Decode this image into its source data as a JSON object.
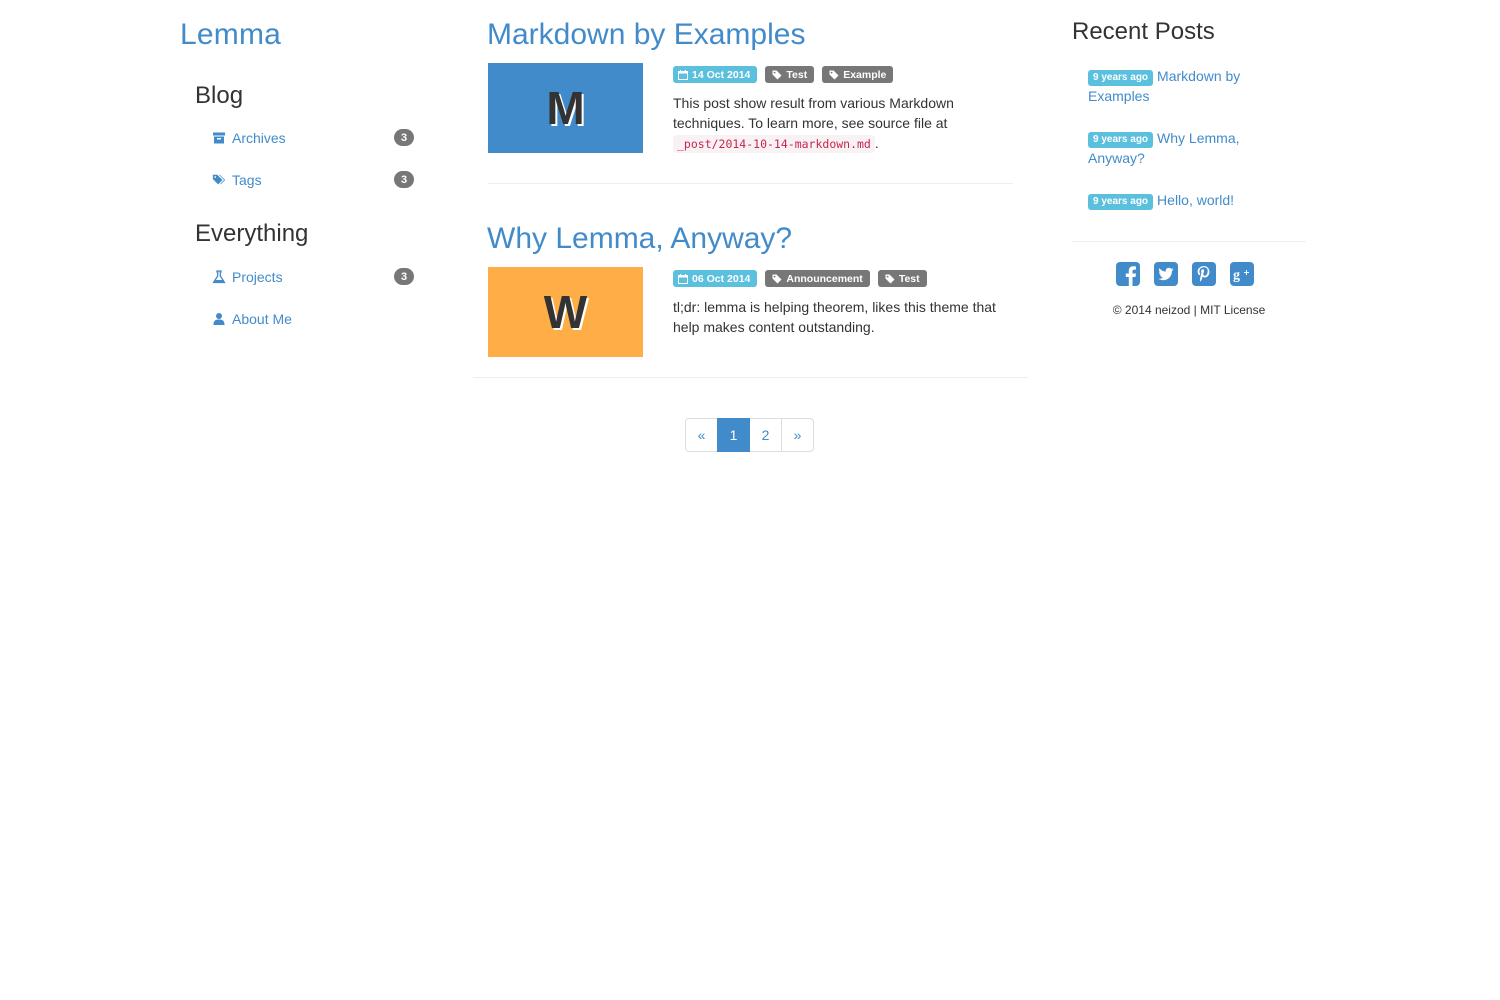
{
  "site": {
    "title": "Lemma"
  },
  "sidebar": {
    "sections": [
      {
        "heading": "Blog",
        "items": [
          {
            "label": "Archives",
            "icon": "archive-icon",
            "count": "3"
          },
          {
            "label": "Tags",
            "icon": "tags-icon",
            "count": "3"
          }
        ]
      },
      {
        "heading": "Everything",
        "items": [
          {
            "label": "Projects",
            "icon": "flask-icon",
            "count": "3"
          },
          {
            "label": "About Me",
            "icon": "user-icon",
            "count": ""
          }
        ]
      }
    ]
  },
  "posts": [
    {
      "title": "Markdown by Examples",
      "thumb_letter": "M",
      "thumb_color": "#428bca",
      "date": "14 Oct 2014",
      "tags": [
        "Test",
        "Example"
      ],
      "excerpt_text": "This post show result from various Markdown techniques. To learn more, see source file at ",
      "excerpt_code": "_post/2014-10-14-markdown.md",
      "excerpt_end": "."
    },
    {
      "title": "Why Lemma, Anyway?",
      "thumb_letter": "W",
      "thumb_color": "#ffad47",
      "date": "06 Oct 2014",
      "tags": [
        "Announcement",
        "Test"
      ],
      "excerpt_text": "tl;dr: lemma is helping theorem, likes this theme that help makes content outstanding.",
      "excerpt_code": "",
      "excerpt_end": ""
    }
  ],
  "pagination": {
    "prev": "«",
    "pages": [
      "1",
      "2"
    ],
    "next": "»",
    "current": "1"
  },
  "recent": {
    "heading": "Recent Posts",
    "items": [
      {
        "ago": "9 years ago",
        "title": "Markdown by Examples"
      },
      {
        "ago": "9 years ago",
        "title": "Why Lemma, Anyway?"
      },
      {
        "ago": "9 years ago",
        "title": "Hello, world!"
      }
    ]
  },
  "social": [
    "facebook-icon",
    "twitter-icon",
    "pinterest-icon",
    "google-plus-icon"
  ],
  "footer": {
    "text": "© 2014 neizod | MIT License"
  },
  "colors": {
    "accent": "#428bca",
    "info": "#5bc0de",
    "tag": "#777777",
    "badge": "#777777"
  }
}
